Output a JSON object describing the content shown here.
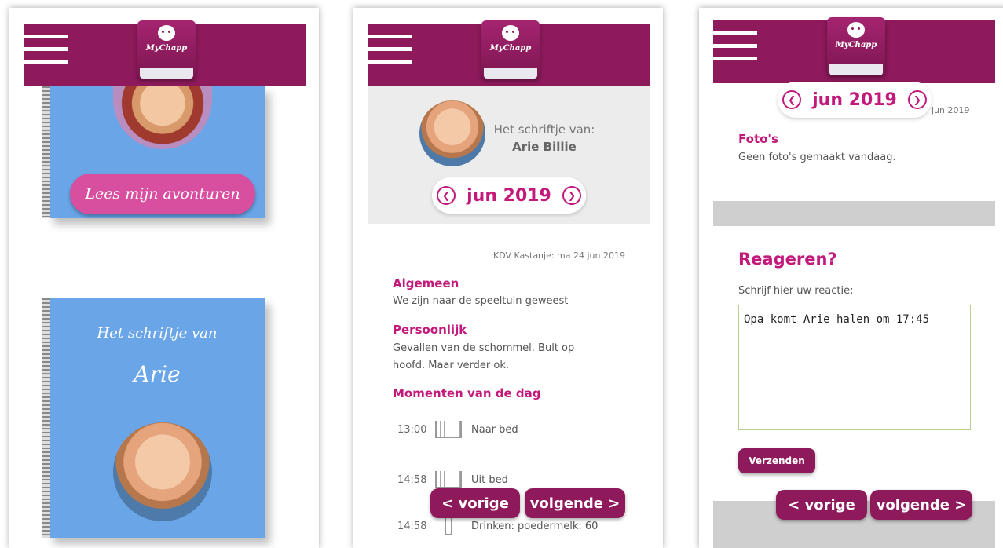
{
  "app": {
    "logo_text": "MyChapp"
  },
  "screen1": {
    "read_button": "Lees mijn avonturen",
    "notebook_title": "Het schriftje van",
    "notebook_name": "Arie"
  },
  "screen2": {
    "notebook_of_label": "Het schriftje van:",
    "child_name": "Arie Billie",
    "month": "jun 2019",
    "entry_meta": "KDV Kastanje: ma 24 jun 2019",
    "sections": [
      {
        "title": "Algemeen",
        "text": "We zijn naar de speeltuin geweest"
      },
      {
        "title": "Persoonlijk",
        "text_lines": [
          "Gevallen van de schommel. Bult op",
          "hoofd. Maar verder ok."
        ]
      },
      {
        "title": "Momenten van de dag"
      }
    ],
    "moments": [
      {
        "time": "13:00",
        "icon": "crib-icon",
        "label": "Naar bed"
      },
      {
        "time": "14:58",
        "icon": "crib-icon",
        "label": "Uit bed"
      },
      {
        "time": "14:58",
        "icon": "bottle-icon",
        "label": "Drinken: poedermelk: 60"
      }
    ],
    "prev_label": "< vorige",
    "next_label": "volgende >"
  },
  "screen3": {
    "month": "jun 2019",
    "date_fragment": "jun 2019",
    "photos_title": "Foto's",
    "photos_text": "Geen foto's gemaakt vandaag.",
    "reply_title": "Reageren?",
    "reply_prompt": "Schrijf hier uw reactie:",
    "reply_value": "Opa komt Arie halen om 17:45",
    "send_label": "Verzenden",
    "prev_label": "< vorige",
    "next_label": "volgende >"
  },
  "colors": {
    "brand": "#8e1a5c",
    "accent": "#c2197b",
    "notebook": "#6aa5e8",
    "button_pink": "#d94fa0"
  }
}
